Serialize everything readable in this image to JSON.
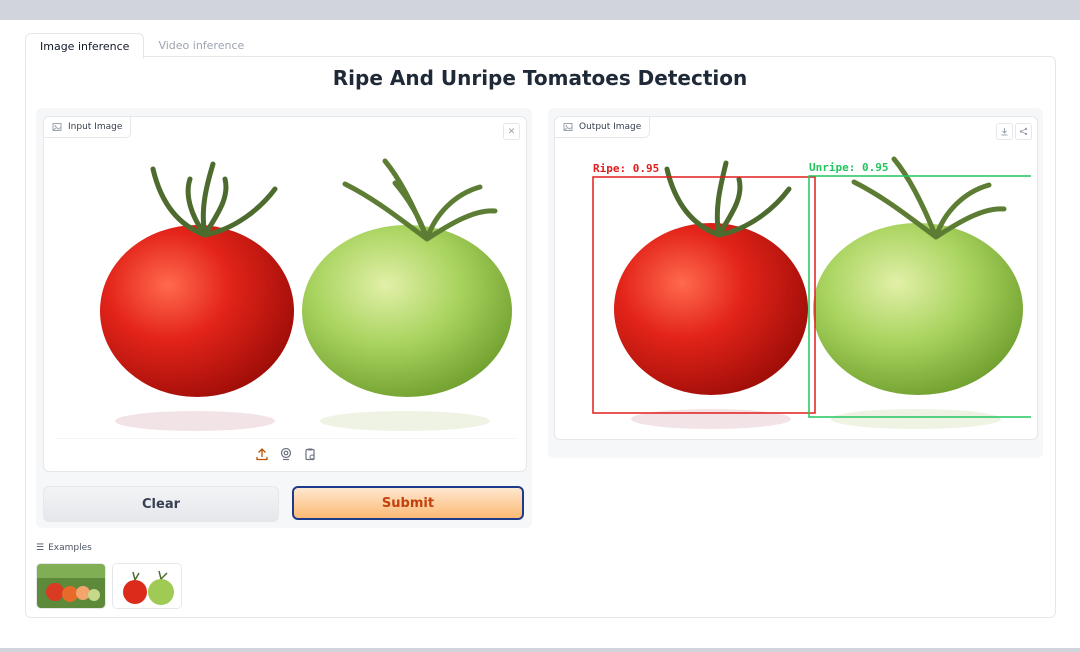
{
  "tabs": [
    {
      "label": "Image inference"
    },
    {
      "label": "Video inference"
    }
  ],
  "page": {
    "title": "Ripe And Unripe Tomatoes Detection"
  },
  "input": {
    "label": "Input Image"
  },
  "output": {
    "label": "Output Image"
  },
  "detections": [
    {
      "label": "Ripe: 0.95",
      "color": "#e11d1d"
    },
    {
      "label": "Unripe: 0.95",
      "color": "#22c55e"
    }
  ],
  "buttons": {
    "clear": "Clear",
    "submit": "Submit"
  },
  "examples": {
    "label": "Examples"
  },
  "colors": {
    "ripe": "#e11d1d",
    "unripe": "#22c55e",
    "submit_border": "#1e3a8a",
    "submit_text": "#c2410c"
  }
}
